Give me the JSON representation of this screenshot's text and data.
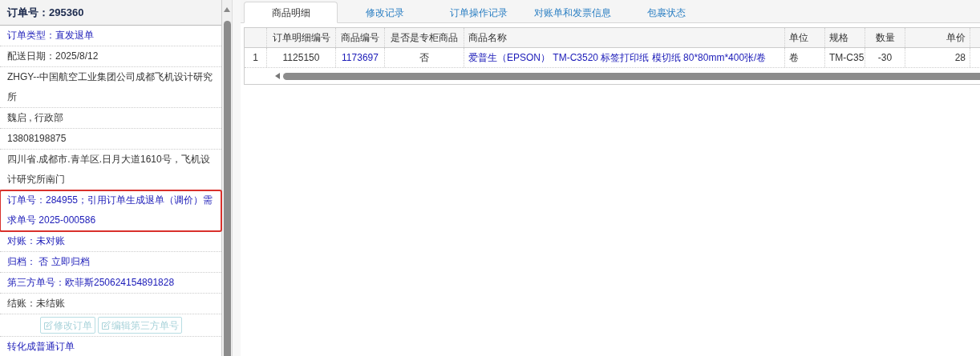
{
  "order_panel": {
    "title": "订单号：295360",
    "items": [
      {
        "kind": "link",
        "text": "订单类型：直发退单",
        "highlighted": false
      },
      {
        "kind": "plain",
        "text": "配送日期：2025/8/12",
        "highlighted": false
      },
      {
        "kind": "plain",
        "text": "ZHGY--中国航空工业集团公司成都飞机设计研究所",
        "highlighted": false
      },
      {
        "kind": "plain",
        "text": "魏启 , 行政部",
        "highlighted": false
      },
      {
        "kind": "plain",
        "text": "13808198875",
        "highlighted": false
      },
      {
        "kind": "plain",
        "text": "四川省.成都市.青羊区.日月大道1610号，飞机设计研究所南门",
        "highlighted": false
      },
      {
        "kind": "link",
        "text": "订单号：284955；引用订单生成退单（调价）需求单号 2025-000586",
        "highlighted": true
      },
      {
        "kind": "link",
        "text": "对账：未对账",
        "highlighted": false
      },
      {
        "kind": "link",
        "text": "归档：  否 立即归档",
        "highlighted": false
      },
      {
        "kind": "link",
        "text": "第三方单号：欧菲斯250624154891828",
        "highlighted": false
      },
      {
        "kind": "plain",
        "text": "结账：未结账",
        "highlighted": false
      },
      {
        "kind": "buttons",
        "buttons": [
          {
            "label": "修改订单",
            "disabled": true
          },
          {
            "label": "编辑第三方单号",
            "disabled": true
          }
        ],
        "highlighted": false
      },
      {
        "kind": "link",
        "text": "转化成普通订单",
        "highlighted": false
      }
    ]
  },
  "tabs": [
    {
      "label": "商品明细",
      "selected": true
    },
    {
      "label": "修改记录",
      "selected": false
    },
    {
      "label": "订单操作记录",
      "selected": false
    },
    {
      "label": "对账单和发票信息",
      "selected": false
    },
    {
      "label": "包裹状态",
      "selected": false
    }
  ],
  "table": {
    "columns": [
      {
        "label": "订单明细编号"
      },
      {
        "label": "商品编号"
      },
      {
        "label": "是否是专柜商品"
      },
      {
        "label": "商品名称"
      },
      {
        "label": "单位"
      },
      {
        "label": "规格"
      },
      {
        "label": "数量"
      },
      {
        "label": "单价"
      }
    ],
    "rows": [
      {
        "number": "1",
        "cells": [
          {
            "text": "1125150",
            "link": false
          },
          {
            "text": "1173697",
            "link": true
          },
          {
            "text": "否",
            "link": false
          },
          {
            "text": "爱普生（EPSON） TM-C3520 标签打印纸 模切纸 80*80mm*400张/卷",
            "link": true
          },
          {
            "text": "卷",
            "link": false
          },
          {
            "text": "TM-C35",
            "link": false
          },
          {
            "text": "-30",
            "link": false
          },
          {
            "text": "28",
            "link": false
          }
        ]
      }
    ]
  }
}
